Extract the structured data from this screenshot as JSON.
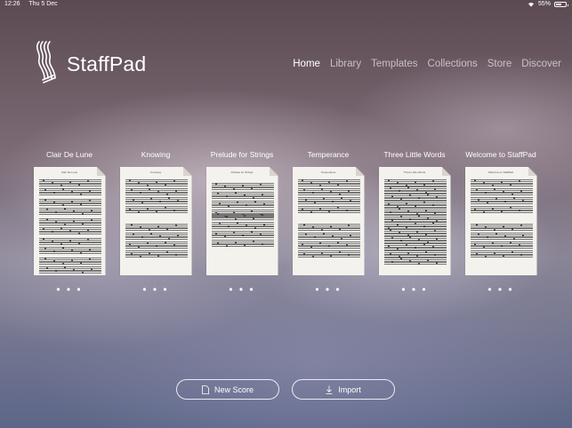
{
  "status": {
    "time": "12:26",
    "date": "Thu 5 Dec",
    "battery": "55%"
  },
  "app": {
    "name": "StaffPad"
  },
  "nav": {
    "items": [
      {
        "label": "Home",
        "active": true
      },
      {
        "label": "Library",
        "active": false
      },
      {
        "label": "Templates",
        "active": false
      },
      {
        "label": "Collections",
        "active": false
      },
      {
        "label": "Store",
        "active": false
      },
      {
        "label": "Discover",
        "active": false
      }
    ]
  },
  "scores": [
    {
      "title": "Clair De Lune",
      "page_title": "Clair De Lune",
      "more": "• • •"
    },
    {
      "title": "Knowing",
      "page_title": "Knowing",
      "more": "• • •"
    },
    {
      "title": "Prelude for Strings",
      "page_title": "Prelude for Strings",
      "more": "• • •"
    },
    {
      "title": "Temperance",
      "page_title": "Temperance",
      "more": "• • •"
    },
    {
      "title": "Three Little Words",
      "page_title": "Three Little Words",
      "more": "• • •"
    },
    {
      "title": "Welcome to StaffPad",
      "page_title": "Welcome to StaffPad",
      "more": "• • •"
    }
  ],
  "actions": {
    "new_score": "New Score",
    "import": "Import"
  },
  "colors": {
    "accent": "#ffffff",
    "nav_inactive": "#b9b3bd"
  }
}
